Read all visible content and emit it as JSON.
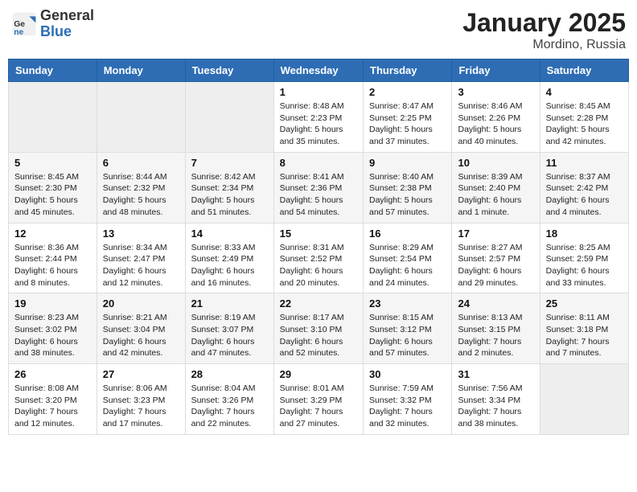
{
  "header": {
    "logo_general": "General",
    "logo_blue": "Blue",
    "title": "January 2025",
    "location": "Mordino, Russia"
  },
  "days_of_week": [
    "Sunday",
    "Monday",
    "Tuesday",
    "Wednesday",
    "Thursday",
    "Friday",
    "Saturday"
  ],
  "weeks": [
    [
      {
        "day": "",
        "info": ""
      },
      {
        "day": "",
        "info": ""
      },
      {
        "day": "",
        "info": ""
      },
      {
        "day": "1",
        "info": "Sunrise: 8:48 AM\nSunset: 2:23 PM\nDaylight: 5 hours and 35 minutes."
      },
      {
        "day": "2",
        "info": "Sunrise: 8:47 AM\nSunset: 2:25 PM\nDaylight: 5 hours and 37 minutes."
      },
      {
        "day": "3",
        "info": "Sunrise: 8:46 AM\nSunset: 2:26 PM\nDaylight: 5 hours and 40 minutes."
      },
      {
        "day": "4",
        "info": "Sunrise: 8:45 AM\nSunset: 2:28 PM\nDaylight: 5 hours and 42 minutes."
      }
    ],
    [
      {
        "day": "5",
        "info": "Sunrise: 8:45 AM\nSunset: 2:30 PM\nDaylight: 5 hours and 45 minutes."
      },
      {
        "day": "6",
        "info": "Sunrise: 8:44 AM\nSunset: 2:32 PM\nDaylight: 5 hours and 48 minutes."
      },
      {
        "day": "7",
        "info": "Sunrise: 8:42 AM\nSunset: 2:34 PM\nDaylight: 5 hours and 51 minutes."
      },
      {
        "day": "8",
        "info": "Sunrise: 8:41 AM\nSunset: 2:36 PM\nDaylight: 5 hours and 54 minutes."
      },
      {
        "day": "9",
        "info": "Sunrise: 8:40 AM\nSunset: 2:38 PM\nDaylight: 5 hours and 57 minutes."
      },
      {
        "day": "10",
        "info": "Sunrise: 8:39 AM\nSunset: 2:40 PM\nDaylight: 6 hours and 1 minute."
      },
      {
        "day": "11",
        "info": "Sunrise: 8:37 AM\nSunset: 2:42 PM\nDaylight: 6 hours and 4 minutes."
      }
    ],
    [
      {
        "day": "12",
        "info": "Sunrise: 8:36 AM\nSunset: 2:44 PM\nDaylight: 6 hours and 8 minutes."
      },
      {
        "day": "13",
        "info": "Sunrise: 8:34 AM\nSunset: 2:47 PM\nDaylight: 6 hours and 12 minutes."
      },
      {
        "day": "14",
        "info": "Sunrise: 8:33 AM\nSunset: 2:49 PM\nDaylight: 6 hours and 16 minutes."
      },
      {
        "day": "15",
        "info": "Sunrise: 8:31 AM\nSunset: 2:52 PM\nDaylight: 6 hours and 20 minutes."
      },
      {
        "day": "16",
        "info": "Sunrise: 8:29 AM\nSunset: 2:54 PM\nDaylight: 6 hours and 24 minutes."
      },
      {
        "day": "17",
        "info": "Sunrise: 8:27 AM\nSunset: 2:57 PM\nDaylight: 6 hours and 29 minutes."
      },
      {
        "day": "18",
        "info": "Sunrise: 8:25 AM\nSunset: 2:59 PM\nDaylight: 6 hours and 33 minutes."
      }
    ],
    [
      {
        "day": "19",
        "info": "Sunrise: 8:23 AM\nSunset: 3:02 PM\nDaylight: 6 hours and 38 minutes."
      },
      {
        "day": "20",
        "info": "Sunrise: 8:21 AM\nSunset: 3:04 PM\nDaylight: 6 hours and 42 minutes."
      },
      {
        "day": "21",
        "info": "Sunrise: 8:19 AM\nSunset: 3:07 PM\nDaylight: 6 hours and 47 minutes."
      },
      {
        "day": "22",
        "info": "Sunrise: 8:17 AM\nSunset: 3:10 PM\nDaylight: 6 hours and 52 minutes."
      },
      {
        "day": "23",
        "info": "Sunrise: 8:15 AM\nSunset: 3:12 PM\nDaylight: 6 hours and 57 minutes."
      },
      {
        "day": "24",
        "info": "Sunrise: 8:13 AM\nSunset: 3:15 PM\nDaylight: 7 hours and 2 minutes."
      },
      {
        "day": "25",
        "info": "Sunrise: 8:11 AM\nSunset: 3:18 PM\nDaylight: 7 hours and 7 minutes."
      }
    ],
    [
      {
        "day": "26",
        "info": "Sunrise: 8:08 AM\nSunset: 3:20 PM\nDaylight: 7 hours and 12 minutes."
      },
      {
        "day": "27",
        "info": "Sunrise: 8:06 AM\nSunset: 3:23 PM\nDaylight: 7 hours and 17 minutes."
      },
      {
        "day": "28",
        "info": "Sunrise: 8:04 AM\nSunset: 3:26 PM\nDaylight: 7 hours and 22 minutes."
      },
      {
        "day": "29",
        "info": "Sunrise: 8:01 AM\nSunset: 3:29 PM\nDaylight: 7 hours and 27 minutes."
      },
      {
        "day": "30",
        "info": "Sunrise: 7:59 AM\nSunset: 3:32 PM\nDaylight: 7 hours and 32 minutes."
      },
      {
        "day": "31",
        "info": "Sunrise: 7:56 AM\nSunset: 3:34 PM\nDaylight: 7 hours and 38 minutes."
      },
      {
        "day": "",
        "info": ""
      }
    ]
  ]
}
